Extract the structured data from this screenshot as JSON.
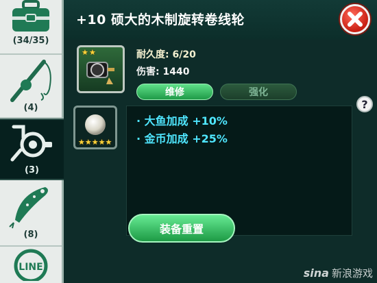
{
  "header": {
    "title": "+10 硕大的木制旋转卷线轮"
  },
  "sidebar": {
    "tabs": [
      {
        "icon": "tackle-box-icon",
        "count": "(34/35)"
      },
      {
        "icon": "fishing-rod-icon",
        "count": "(4)"
      },
      {
        "icon": "reel-icon",
        "count": "(3)",
        "active": true
      },
      {
        "icon": "lure-icon",
        "count": "(8)"
      },
      {
        "icon": "line-icon",
        "label": "LINE"
      }
    ]
  },
  "item": {
    "icon": "reel-item-icon",
    "stars": 2,
    "durability": "耐久度: 6/20",
    "damage": "伤害:  1440",
    "repair_label": "维修",
    "strengthen_label": "强化"
  },
  "gem": {
    "icon": "pearl-icon",
    "stars": 5
  },
  "bonuses": [
    "· 大鱼加成 +10%",
    "· 金币加成 +25%"
  ],
  "help_label": "?",
  "reset_label": "装备重置",
  "watermark": {
    "brand": "sina",
    "text": "新浪游戏"
  },
  "colors": {
    "accent_green": "#1f9a47",
    "bonus_text": "#4fe6ff",
    "close_red": "#c81e12"
  }
}
